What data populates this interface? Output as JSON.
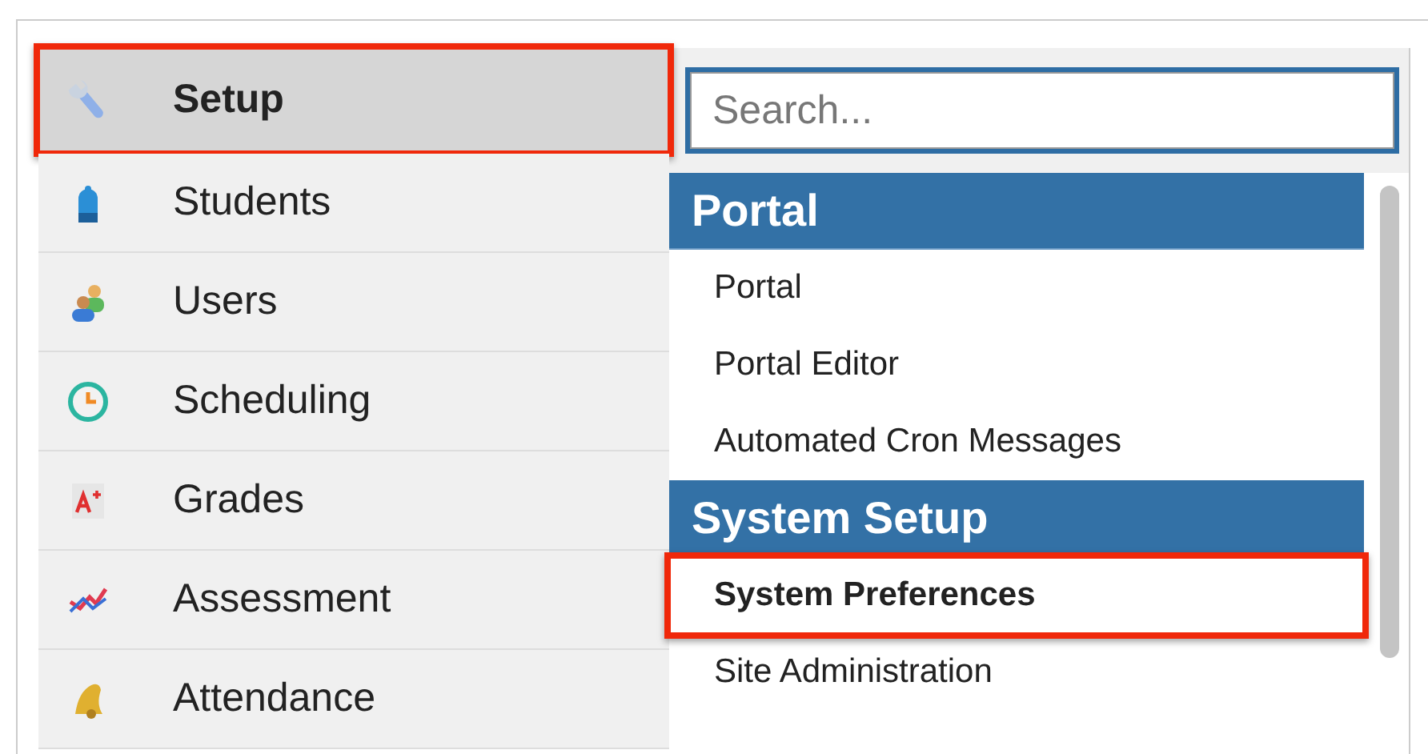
{
  "nav": [
    {
      "label": "Setup",
      "kind": "wrench",
      "selected": true,
      "highlighted": true
    },
    {
      "label": "Students",
      "kind": "backpack",
      "selected": false,
      "highlighted": false
    },
    {
      "label": "Users",
      "kind": "users",
      "selected": false,
      "highlighted": false
    },
    {
      "label": "Scheduling",
      "kind": "clock",
      "selected": false,
      "highlighted": false
    },
    {
      "label": "Grades",
      "kind": "grade",
      "selected": false,
      "highlighted": false
    },
    {
      "label": "Assessment",
      "kind": "chart",
      "selected": false,
      "highlighted": false
    },
    {
      "label": "Attendance",
      "kind": "bell",
      "selected": false,
      "highlighted": false
    }
  ],
  "search": {
    "placeholder": "Search..."
  },
  "menu": [
    {
      "kind": "header",
      "label": "Portal"
    },
    {
      "kind": "item",
      "label": "Portal",
      "selected": false,
      "highlighted": false
    },
    {
      "kind": "item",
      "label": "Portal Editor",
      "selected": false,
      "highlighted": false
    },
    {
      "kind": "item",
      "label": "Automated Cron Messages",
      "selected": false,
      "highlighted": false
    },
    {
      "kind": "header",
      "label": "System Setup"
    },
    {
      "kind": "item",
      "label": "System Preferences",
      "selected": true,
      "highlighted": true
    },
    {
      "kind": "item",
      "label": "Site Administration",
      "selected": false,
      "highlighted": false
    }
  ]
}
